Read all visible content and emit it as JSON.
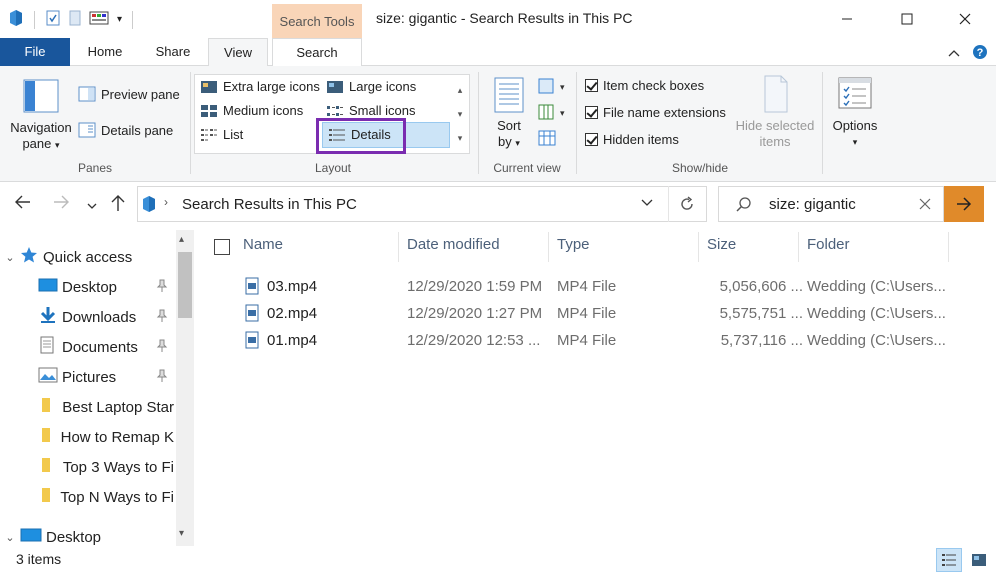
{
  "title_bar": {
    "context_tab": "Search Tools",
    "window_title": "size: gigantic - Search Results in This PC"
  },
  "ribbon_tabs": {
    "file": "File",
    "home": "Home",
    "share": "Share",
    "view": "View",
    "search": "Search"
  },
  "ribbon": {
    "panes": {
      "navigation_pane_line1": "Navigation",
      "navigation_pane_line2": "pane",
      "preview_pane": "Preview pane",
      "details_pane": "Details pane",
      "group_label": "Panes"
    },
    "layout": {
      "extra_large_icons": "Extra large icons",
      "large_icons": "Large icons",
      "medium_icons": "Medium icons",
      "small_icons": "Small icons",
      "list": "List",
      "details": "Details",
      "group_label": "Layout"
    },
    "current_view": {
      "sort_by_line1": "Sort",
      "sort_by_line2": "by",
      "group_label": "Current view"
    },
    "show_hide": {
      "item_check_boxes": "Item check boxes",
      "file_name_extensions": "File name extensions",
      "hidden_items": "Hidden items",
      "hide_selected_line1": "Hide selected",
      "hide_selected_line2": "items",
      "group_label": "Show/hide"
    },
    "options": {
      "label": "Options"
    }
  },
  "address_bar": {
    "path": "Search Results in This PC"
  },
  "search_box": {
    "value": "size: gigantic"
  },
  "nav_pane": {
    "items": [
      {
        "label": "Quick access"
      },
      {
        "label": "Desktop"
      },
      {
        "label": "Downloads"
      },
      {
        "label": "Documents"
      },
      {
        "label": "Pictures"
      },
      {
        "label": "Best Laptop Star"
      },
      {
        "label": "How to Remap K"
      },
      {
        "label": "Top 3 Ways to Fi"
      },
      {
        "label": "Top N Ways to Fi"
      },
      {
        "label": "Desktop"
      }
    ]
  },
  "columns": {
    "name": "Name",
    "date_modified": "Date modified",
    "type": "Type",
    "size": "Size",
    "folder": "Folder"
  },
  "files": [
    {
      "name": "03.mp4",
      "date": "12/29/2020 1:59 PM",
      "type": "MP4 File",
      "size": "5,056,606 ...",
      "folder": "Wedding (C:\\Users..."
    },
    {
      "name": "02.mp4",
      "date": "12/29/2020 1:27 PM",
      "type": "MP4 File",
      "size": "5,575,751 ...",
      "folder": "Wedding (C:\\Users..."
    },
    {
      "name": "01.mp4",
      "date": "12/29/2020 12:53 ...",
      "type": "MP4 File",
      "size": "5,737,116 ...",
      "folder": "Wedding (C:\\Users..."
    }
  ],
  "status_bar": {
    "item_count": "3 items"
  },
  "colors": {
    "file_tab": "#19569c",
    "context_tab": "#f9d5b8",
    "highlight_box": "#7a2cb0",
    "go_button": "#e08a2a"
  }
}
